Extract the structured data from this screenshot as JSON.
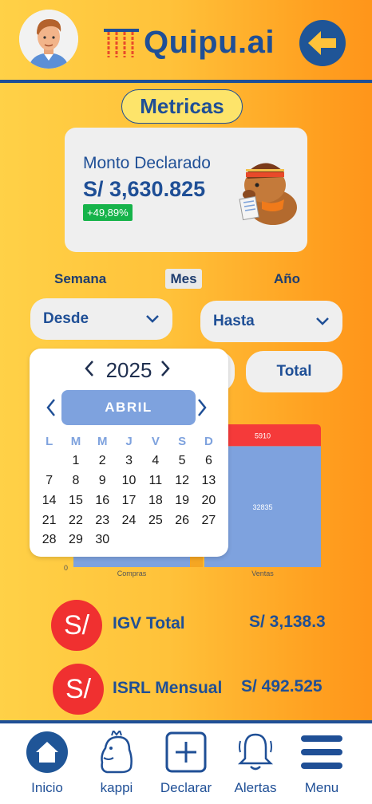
{
  "header": {
    "logo_text": "Quipu.ai",
    "avatar_icon": "avatar-icon",
    "back_icon": "arrow-left-icon"
  },
  "metricas": {
    "title": "Metricas"
  },
  "monto": {
    "label": "Monto Declarado",
    "value": "S/ 3,630.825",
    "change": "+49,89%"
  },
  "period_tabs": [
    "Semana",
    "Mes",
    "Año"
  ],
  "selected_period": "Mes",
  "filters": {
    "desde_label": "Desde",
    "hasta_label": "Hasta",
    "total_label": "Total"
  },
  "calendar": {
    "year": "2025",
    "month": "ABRIL",
    "weekdays": [
      "L",
      "M",
      "M",
      "J",
      "V",
      "S",
      "D"
    ],
    "start_offset": 1,
    "days": [
      1,
      2,
      3,
      4,
      5,
      6,
      7,
      8,
      9,
      10,
      11,
      12,
      13,
      14,
      15,
      16,
      17,
      18,
      19,
      20,
      21,
      22,
      23,
      24,
      25,
      26,
      27,
      28,
      29,
      30
    ]
  },
  "chart_data": {
    "type": "bar",
    "categories": [
      "Compras",
      "Ventas"
    ],
    "series": [
      {
        "name": "",
        "values": [
          null,
          32835
        ],
        "color": "#7ea2de"
      },
      {
        "name": "",
        "values": [
          null,
          5910
        ],
        "color": "#f53a3a"
      }
    ],
    "stacked": true,
    "y_tick_labels": [
      "0"
    ],
    "data_labels": [
      "32835",
      "5910"
    ]
  },
  "summary": [
    {
      "icon_text": "S/",
      "label": "IGV Total",
      "value": "S/ 3,138.3"
    },
    {
      "icon_text": "S/",
      "label": "ISRL Mensual",
      "value": "S/ 492.525"
    }
  ],
  "nav": [
    {
      "label": "Inicio",
      "icon": "home-icon"
    },
    {
      "label": "kappi",
      "icon": "capybara-icon"
    },
    {
      "label": "Declarar",
      "icon": "plus-square-icon"
    },
    {
      "label": "Alertas",
      "icon": "bell-icon"
    },
    {
      "label": "Menu",
      "icon": "menu-icon"
    }
  ]
}
